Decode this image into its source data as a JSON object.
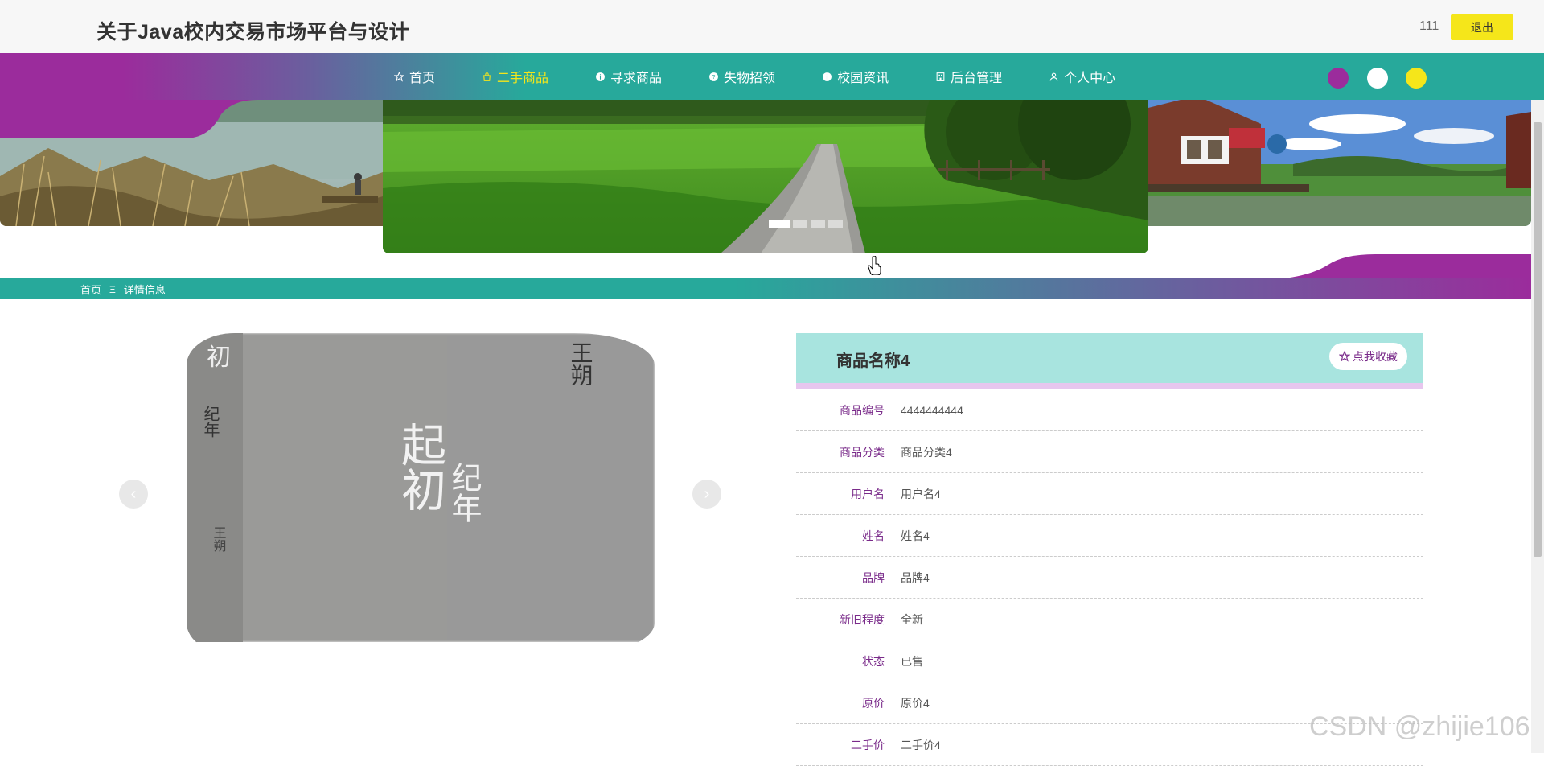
{
  "header": {
    "site_title": "关于Java校内交易市场平台与设计",
    "username": "111",
    "logout_label": "退出"
  },
  "nav": {
    "items": [
      {
        "label": "首页",
        "icon": "star-icon"
      },
      {
        "label": "二手商品",
        "icon": "bag-icon"
      },
      {
        "label": "寻求商品",
        "icon": "info-icon"
      },
      {
        "label": "失物招领",
        "icon": "question-icon"
      },
      {
        "label": "校园资讯",
        "icon": "info-icon"
      },
      {
        "label": "后台管理",
        "icon": "building-icon"
      },
      {
        "label": "个人中心",
        "icon": "user-icon"
      }
    ],
    "active_index": 1,
    "theme_colors": [
      "#9b2c9c",
      "#ffffff",
      "#f5e61a"
    ]
  },
  "banner": {
    "slide_count": 4,
    "active_slide": 0
  },
  "breadcrumb": {
    "home": "首页",
    "separator": "Ξ",
    "current": "详情信息"
  },
  "gallery": {
    "prev_label": "‹",
    "next_label": "›",
    "cover_text_top": "起初",
    "cover_text_sub": "纪年",
    "cover_author": "王朔",
    "spine_title": "初",
    "spine_sub": "纪年",
    "spine_author": "王朔"
  },
  "detail": {
    "product_name": "商品名称4",
    "favorite_label": "点我收藏",
    "rows": [
      {
        "label": "商品编号",
        "value": "4444444444"
      },
      {
        "label": "商品分类",
        "value": "商品分类4"
      },
      {
        "label": "用户名",
        "value": "用户名4"
      },
      {
        "label": "姓名",
        "value": "姓名4"
      },
      {
        "label": "品牌",
        "value": "品牌4"
      },
      {
        "label": "新旧程度",
        "value": "全新"
      },
      {
        "label": "状态",
        "value": "已售"
      },
      {
        "label": "原价",
        "value": "原价4"
      },
      {
        "label": "二手价",
        "value": "二手价4"
      }
    ]
  },
  "watermark": "CSDN @zhijie106",
  "colors": {
    "primary_teal": "#27a99b",
    "primary_purple": "#9b2c9c",
    "accent_yellow": "#f5e61a",
    "label_purple": "#7a2b8a",
    "header_teal_light": "#a8e4df"
  }
}
